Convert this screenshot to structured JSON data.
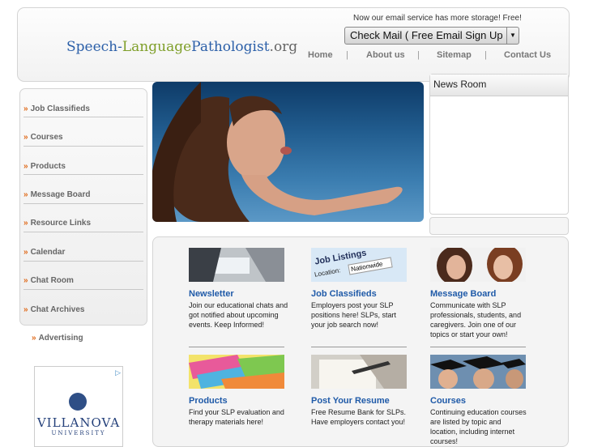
{
  "header": {
    "logo": {
      "part1": "Speech-",
      "part2": "Language",
      "part3": "Pathologist",
      "part4": ".org"
    },
    "email_note": "Now our email service has more storage! Free!",
    "email_select": "Check Mail ( Free Email Sign Up",
    "nav": [
      "Home",
      "About us",
      "Sitemap",
      "Contact Us"
    ],
    "separator": "|"
  },
  "sidebar": {
    "bullet": "»",
    "items": [
      "Job Classifieds",
      "Courses",
      "Products",
      "Message Board",
      "Resource Links",
      "Calendar",
      "Chat Room",
      "Chat Archives"
    ],
    "standalone": "Advertising"
  },
  "ad": {
    "choice": "▷",
    "name": "VILLANOVA",
    "sub": "UNIVERSITY"
  },
  "news": {
    "title": "News Room"
  },
  "job_image": {
    "line1": "Job Listings",
    "location_label": "Location:",
    "location_value": "Nationwide"
  },
  "cards": [
    {
      "title": "Newsletter",
      "text": "Join our educational chats and\ngot notified about upcoming\nevents. Keep Informed!"
    },
    {
      "title": "Job Classifieds",
      "text": "Employers post your SLP\npositions here! SLPs, start\nyour job search now!"
    },
    {
      "title": "Message Board",
      "text": "Communicate with SLP\nprofessionals, students, and\ncaregivers. Join one of our\ntopics or start your own!"
    },
    {
      "title": "Products",
      "text": "Find your SLP evaluation and\ntherapy materials here!"
    },
    {
      "title": "Post Your Resume",
      "text": "Free Resume Bank for SLPs.\nHave employers contact you!"
    },
    {
      "title": "Courses",
      "text": "Continuing education courses\nare listed by topic and\nlocation, including internet\ncourses!"
    }
  ],
  "colors": {
    "link_blue": "#1f5aa8",
    "bullet_orange": "#e06a1a",
    "nav_gray": "#777777"
  }
}
